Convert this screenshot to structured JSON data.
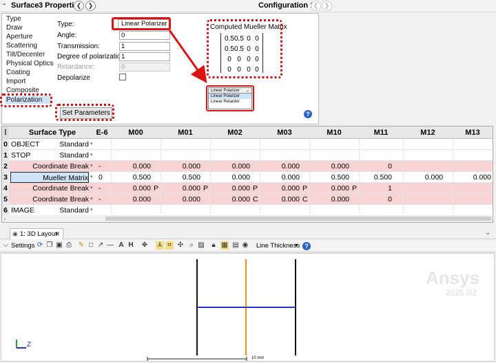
{
  "header": {
    "surface_label": "Surface",
    "properties_label": "3 Properties",
    "configuration_label": "Configuration 1/1"
  },
  "props": {
    "categories": [
      "Type",
      "Draw",
      "Aperture",
      "Scattering",
      "Tilt/Decenter",
      "Physical Optics",
      "Coating",
      "Import",
      "Composite",
      "Polarization"
    ],
    "selected_category": "Polarization",
    "type_label": "Type:",
    "type_value": "Linear Polarizer",
    "angle_label": "Angle:",
    "angle_value": "0",
    "transmission_label": "Transmission:",
    "transmission_value": "1",
    "degree_label": "Degree of polarization:",
    "degree_value": "1",
    "retardance_label": "Retardance:",
    "retardance_value": "0",
    "depolarize_label": "Depolarize",
    "set_params_label": "Set Parameters",
    "matrix_title": "Computed Mueller Matrix",
    "matrix": [
      [
        "0.5",
        "0.5",
        "0",
        "0"
      ],
      [
        "0.5",
        "0.5",
        "0",
        "0"
      ],
      [
        "0",
        "0",
        "0",
        "0"
      ],
      [
        "0",
        "0",
        "0",
        "0"
      ]
    ],
    "dropdown": {
      "header": "Linear Polarizer",
      "options": [
        "Linear Polarizer",
        "Linear Retarder"
      ]
    }
  },
  "sheet": {
    "headers": [
      "Surface Type",
      "E-6",
      "M00",
      "M01",
      "M02",
      "M03",
      "M10",
      "M11",
      "M12",
      "M13"
    ],
    "rows": [
      {
        "num": "0",
        "name": "OBJECT",
        "type": "Standard",
        "pink": false,
        "vals": [
          "",
          "",
          "",
          "",
          "",
          "",
          "",
          ""
        ],
        "flags": [
          "",
          "",
          "",
          "",
          ""
        ]
      },
      {
        "num": "1",
        "name": "STOP",
        "type": "Standard",
        "pink": false,
        "vals": [
          "",
          "",
          "",
          "",
          "",
          "",
          "",
          ""
        ],
        "flags": [
          "",
          "",
          "",
          "",
          ""
        ]
      },
      {
        "num": "2",
        "name": "",
        "type": "Coordinate Break",
        "pink": true,
        "e6": "-",
        "vals": [
          "0.000",
          "0.000",
          "0.000",
          "0.000",
          "0.000",
          "0",
          "",
          ""
        ],
        "flags": [
          "",
          "",
          "",
          "",
          ""
        ]
      },
      {
        "num": "3",
        "name": "",
        "type": "Mueller Matrix",
        "pink": false,
        "e6": "0",
        "vals": [
          "0.500",
          "0.500",
          "0.000",
          "0.000",
          "0.500",
          "0.500",
          "0.000",
          "0.000"
        ],
        "flags": [
          "",
          "",
          "",
          "",
          ""
        ]
      },
      {
        "num": "4",
        "name": "",
        "type": "Coordinate Break",
        "pink": true,
        "e6": "-",
        "vals": [
          "0.000",
          "0.000",
          "0.000",
          "0.000",
          "0.000",
          "1",
          "",
          ""
        ],
        "flags": [
          "P",
          "P",
          "P",
          "P",
          "P"
        ]
      },
      {
        "num": "5",
        "name": "",
        "type": "Coordinate Break",
        "pink": true,
        "e6": "-",
        "vals": [
          "0.000",
          "0.000",
          "0.000",
          "0.000",
          "0.000",
          "0",
          "",
          ""
        ],
        "flags": [
          "",
          "",
          "C",
          "C",
          ""
        ]
      },
      {
        "num": "6",
        "name": "IMAGE",
        "type": "Standard",
        "pink": false,
        "vals": [
          "",
          "",
          "",
          "",
          "",
          "",
          "",
          ""
        ],
        "flags": [
          "",
          "",
          "",
          "",
          ""
        ]
      }
    ]
  },
  "layout": {
    "tab_label": "1: 3D Layout",
    "settings_label": "Settings",
    "line_thickness_label": "Line Thickness",
    "scale_label": "10 mm",
    "axis_label": "Z",
    "watermark_brand": "Ansys",
    "watermark_version": "2025 R2"
  }
}
